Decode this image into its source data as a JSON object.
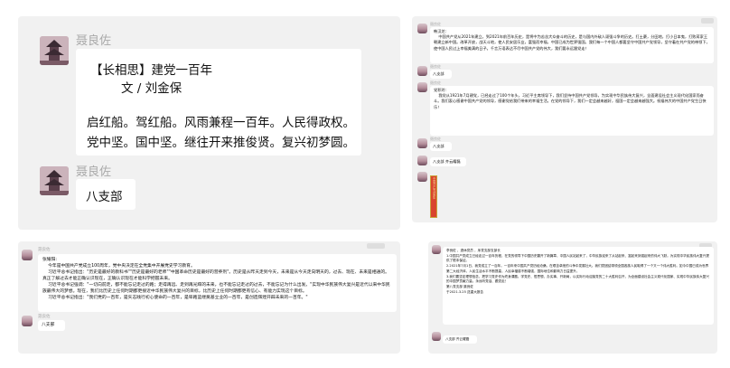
{
  "sender": "聂良佐",
  "main_chat": {
    "title_line": "【长相思】建党一百年",
    "author_line": "文 / 刘金保",
    "poem_line1": "启红船。驾红船。风雨兼程一百年。人民得政权。",
    "poem_line2": "党中坚。国中坚。继往开来推俊贤。复兴初梦圆。",
    "reply": "八支部"
  },
  "thumb_top_right": {
    "msg1": "韩汉芝:\n    中国共产党从2021年建立，到2021年前百年历史，是将中为苦苦大众奋斗的历史，是与国内外敌人顽强斗争的历史。打土豪，分田地，打小日本鬼，打败蒋家王朝建立新中国。改革开放，战天斗地，使人民安居乐业，富强而幸福，中国已成为世界强国。我们每一个中国人都要坚守中国共产党领导，坚守着在共产党的带领下，使中国人民过上幸福美满的日子。千言万语表达不尽中国共产党的伟大，我们要永远跟党走！",
    "msg2": "八支部",
    "msg3": "党积玲:\n    我党从1921年7月建党，已经走过了100个年头，习近平主席领导下，我们坚持中国共产党领导，为实现中华民族伟大复兴，全面建设社会主义现代化国家而奋斗。我们衷心感谢中国共产党的领导，感谢党给我们带来的幸福生活。在党的领导下，我们一定会越来越好，祖国一定会越来越强大。祝福伟大的中国共产党生日快乐！",
    "msg4": "八支部",
    "msg5": "八支部 齐云耀磊",
    "card_text": "中国共产党诗歌集"
  },
  "thumb_bottom_left": {
    "msg1": "张耀阳:\n    今年是中国共产党成立100周年，党中央决定在全党集中开展党史学习教育。\n    习近平总书记指出：\"历史是最好的教科书\"\"历史是最好的老师\"\"中国革命历史是最好的营养剂\"。历史是从昨天走到今天，未来是从今天走向明天的，过去、现在、未来是相通的。真正了解过去才能正确认识现在，正确认识现在才能科学把握未来。\n    习近平总书记强调：\"一切向前走，都不能忘记走过的路；走得再远、走到再光辉的未来，也不能忘记走过的过去，不能忘记为什么出发。\"实现中华民族伟大复兴是近代以来中华民族最伟大的梦想。现在，我们比历史上任何时期都更接近中华民族伟大复兴的目标，比历史上任何时期都更有信心、有能力实现这个目标。\n    习近平总书记指出：\"我们党的一百年，是矢志践行初心使命的一百年，是筚路蓝缕奠基立业的一百年，是创造辉煌开辟未来的一百年。\"",
    "msg2": "八支部"
  },
  "thumb_bottom_right": {
    "msg1": "李良佐 ，退休党员 ，序党支部支部长\n1.中国共产党成立已经走过一百年历程，在党的领导下中国历史翻开了新篇章，中国人民站起来了，中华民族迎来了从站起来、富起来到强起来的伟大飞跃。为实现中华民族伟大复兴提供了根本保证。\n2.2021年7月1日，我党成立了一百年。一百年来中国共产党历经沧桑。在艰苦卓绝的斗争中发展壮大。我们党团结带领全国各族人民取得了一个又一个伟大胜利。如今中国已成为世界第二大经济体，人民生活水平不断提高，人民幸福感不断增强，国际地位和影响力日益提升。\n3.我们要坚定理想信念，把学习党史作为终身课题。学党史、悟思想、办实事、开新局，以实际行动迎接党的二十大胜利召开，为全面建设社会主义现代化国家、实现中华民族伟大复兴的中国梦贡献力量。永远听党话、跟党走！\n第八党支部 聂良佐\n于2021.3.25 送重大报告",
    "msg2": "八支部 齐云耀磊"
  }
}
